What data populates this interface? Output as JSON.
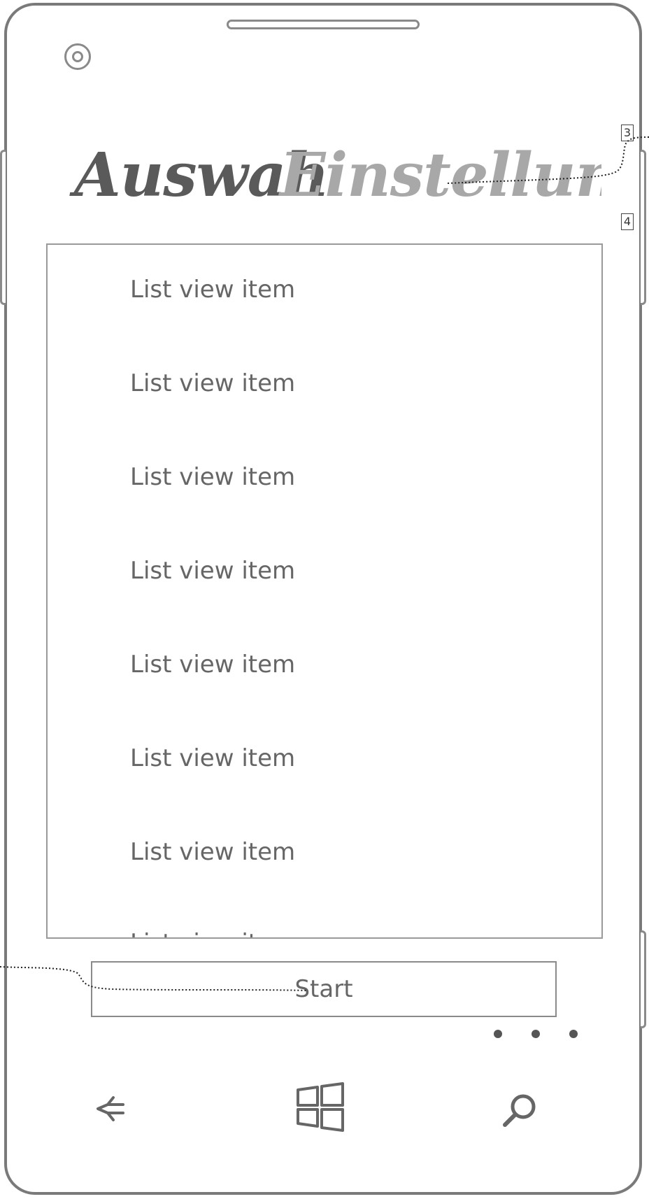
{
  "pivot": {
    "items": [
      {
        "label": "Auswah",
        "state": "active"
      },
      {
        "label": "Einstellungen",
        "state": "inactive"
      }
    ]
  },
  "callouts": [
    "3",
    "4"
  ],
  "list": {
    "items": [
      "List view item",
      "List view item",
      "List view item",
      "List view item",
      "List view item",
      "List view item",
      "List view item",
      "List view item"
    ]
  },
  "start_button": {
    "label": "Start"
  },
  "app_bar": {
    "more_icon": "ellipsis-icon"
  },
  "nav_bar": {
    "back_icon": "back-arrow-icon",
    "home_icon": "windows-logo-icon",
    "search_icon": "search-icon"
  },
  "colors": {
    "frame": "#7a7a7a",
    "active_text": "#5a5a5a",
    "inactive_text": "#a8a8a8"
  }
}
